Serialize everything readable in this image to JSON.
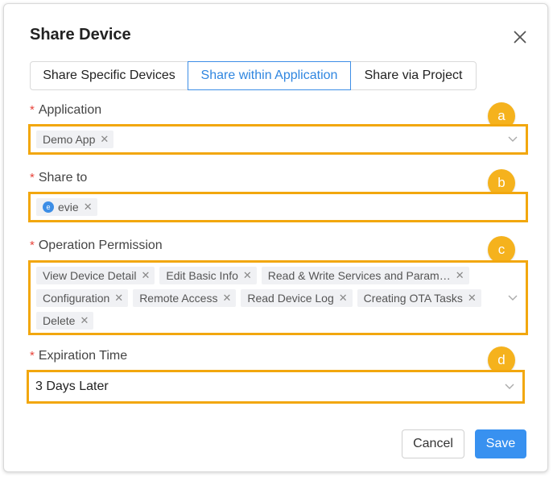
{
  "dialog": {
    "title": "Share Device"
  },
  "tabs": [
    {
      "label": "Share Specific Devices"
    },
    {
      "label": "Share within Application"
    },
    {
      "label": "Share via Project"
    }
  ],
  "fields": {
    "application": {
      "label": "Application",
      "required_mark": "*",
      "badge": "a",
      "tags": [
        "Demo App"
      ]
    },
    "share_to": {
      "label": "Share to",
      "required_mark": "*",
      "badge": "b",
      "tags": [
        {
          "avatar": "e",
          "label": "evie"
        }
      ]
    },
    "operation_permission": {
      "label": "Operation Permission",
      "required_mark": "*",
      "badge": "c",
      "tags": [
        "View Device Detail",
        "Edit Basic Info",
        "Read & Write Services and Param…",
        "Configuration",
        "Remote Access",
        "Read Device Log",
        "Creating OTA Tasks",
        "Delete"
      ]
    },
    "expiration_time": {
      "label": "Expiration Time",
      "required_mark": "*",
      "badge": "d",
      "value": "3 Days Later"
    }
  },
  "footer": {
    "cancel_label": "Cancel",
    "save_label": "Save"
  },
  "colors": {
    "accent": "#3891f0",
    "highlight": "#f2a70e",
    "badge": "#f5b21d",
    "required": "#e8453c"
  },
  "icons": {
    "close": "close-icon",
    "dropdown": "chevron-down-icon",
    "tag_remove": "tag-close-icon"
  }
}
